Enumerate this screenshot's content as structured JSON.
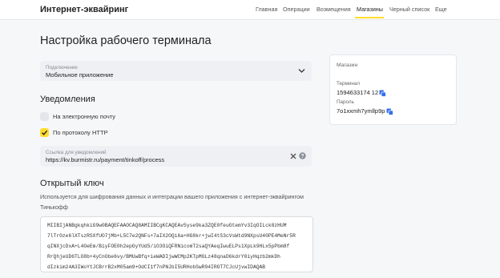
{
  "header": {
    "brand": "Интернет-эквайринг",
    "nav": [
      {
        "label": "Главная"
      },
      {
        "label": "Операции"
      },
      {
        "label": "Возмещения"
      },
      {
        "label": "Магазины",
        "active": true
      },
      {
        "label": "Черный список"
      },
      {
        "label": "Еще"
      }
    ]
  },
  "page": {
    "title": "Настройка рабочего терминала"
  },
  "mode_field": {
    "label": "Подключение",
    "value": "Мобильное приложение",
    "icon": "chevron-down-icon"
  },
  "notifications": {
    "title": "Уведомления",
    "options": [
      {
        "label": "На электронную почту",
        "checked": false
      },
      {
        "label": "По протоколу HTTP",
        "checked": true
      }
    ],
    "url_field": {
      "label": "Ссылка для уведомлений",
      "value": "https://kv.burmistr.ru/payment/tinkoff/process",
      "clear_icon": "close-icon",
      "help_icon": "question-icon"
    }
  },
  "public_key": {
    "title": "Открытый ключ",
    "description_line1": "Используется для шифрования данных и интеграции вашего приложения с интернет-эквайрингом",
    "description_line2": "Тинькофф",
    "lines": [
      "MIIBIjANBgkqhkiG9w0BAQEFAAOCAQ8AMIIBCgKCAQEAv5yse9ka3ZQE0feuGtemYv3IqOILck8zHUM",
      "7lTr0ze6lXTszRSXfUO7jMb+L5C7e2QNFs+7aIX2OQi6a+HG8kr+jwI4tS3cVsWtd9NXpsU40PE4MeNr5R",
      "qINXjcDxA+L4OeEm/BiyFOE0h2epGyYUd5/iO3OiQFRNicomT2saQYAeqIwuELPs1XpLk9HLx5pPbm8f",
      "RrQhjeUD6TLO8b+4yCnObe6vy/BMUwBfq+ieWADIjwWCMp2KTpMGLz48qnaD6kdrY0iyHqzb2mkDh",
      "dIzkim24A3IWoYtJCBrrB2xM05am9+OdCI1f7nPNJbI5URHobSwR94IRGT7CJcUjvwIDAQAB"
    ]
  },
  "shop_card": {
    "title": "Магазин",
    "terminal_label": "Терминал",
    "terminal_value": "1594633174 12",
    "password_label": "Пароль",
    "password_value": "7o1xxmh7ymllp9p",
    "copy_icon": "copy-icon"
  },
  "colors": {
    "accent": "#ffdd2d",
    "link_blue": "#336fee",
    "field_bg": "#eef0f3",
    "page_bg": "#f6f7f8"
  }
}
